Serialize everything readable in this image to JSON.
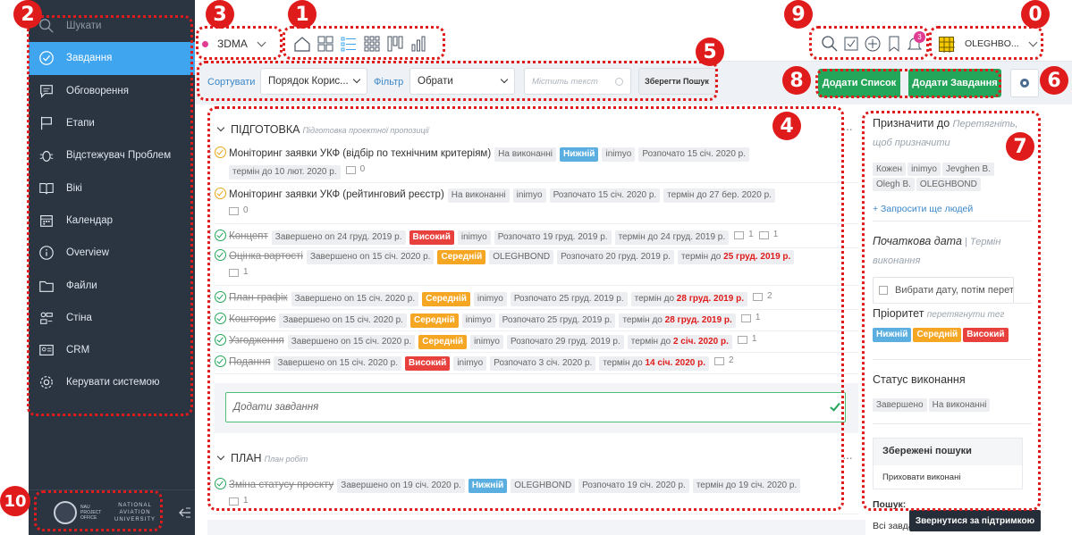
{
  "sidebar": {
    "items": [
      {
        "label": "Шукати",
        "icon": "search-icon"
      },
      {
        "label": "Завдання",
        "icon": "check-circle-icon"
      },
      {
        "label": "Обговорення",
        "icon": "chat-icon"
      },
      {
        "label": "Етапи",
        "icon": "flag-icon"
      },
      {
        "label": "Відстежувач Проблем",
        "icon": "bug-icon"
      },
      {
        "label": "Вікі",
        "icon": "book-icon"
      },
      {
        "label": "Календар",
        "icon": "calendar-icon"
      },
      {
        "label": "Overview",
        "icon": "info-icon"
      },
      {
        "label": "Файли",
        "icon": "folder-icon"
      },
      {
        "label": "Стіна",
        "icon": "wall-icon"
      },
      {
        "label": "CRM",
        "icon": "crm-icon"
      },
      {
        "label": "Керувати системою",
        "icon": "gear-icon"
      }
    ],
    "footer": {
      "logo_text": "NATIONAL AVIATION UNIVERSITY",
      "logo_small": "NAU PROJECT OFFICE"
    }
  },
  "topbar": {
    "project": "ЗDMA",
    "notif_count": "3",
    "user": "OLEGHBO..."
  },
  "toolbar": {
    "sort_label": "Сортувати",
    "sort_value": "Порядок Корис...",
    "filter_label": "Фільтр",
    "filter_value": "Обрати",
    "search_placeholder": "Містить текст",
    "save_search": "Зберегти Пошук",
    "add_list": "Додати Список",
    "add_task": "Додати Завдання"
  },
  "sections": [
    {
      "title": "ПІДГОТОВКА",
      "subtitle": "Підготовка проектної пропозиції",
      "add_placeholder": "Додати завдання"
    },
    {
      "title": "ПЛАН",
      "subtitle": "План робіт"
    }
  ],
  "tasks": [
    {
      "title": "Моніторинг заявки УКФ (відбір по технічним критеріям)",
      "status": "На виконанні",
      "priority": "Нижній",
      "user": "inimyo",
      "started": "Розпочато 15 січ. 2020 р.",
      "due": "термін до 10 лют. 2020 р.",
      "comments": "0"
    },
    {
      "title": "Моніторинг заявки УКФ (рейтинговий реєстр)",
      "status": "На виконанні",
      "user": "inimyo",
      "started": "Розпочато 15 січ. 2020 р.",
      "due": "термін до 27 бер. 2020 р.",
      "comments": "0"
    },
    {
      "title": "Концепт",
      "status": "Завершено on 24 груд. 2019 р.",
      "priority": "Високий",
      "user": "inimyo",
      "started": "Розпочато 19 груд. 2019 р.",
      "due": "термін до 24 груд. 2019 р.",
      "comments": "1",
      "subtasks": "1"
    },
    {
      "title": "Оцінка вартості",
      "status": "Завершено on 15 січ. 2020 р.",
      "priority": "Середній",
      "user": "OLEGHBOND",
      "started": "Розпочато 20 груд. 2019 р.",
      "due_prefix": "термін до ",
      "due_red": "25 груд. 2019 р.",
      "comments": "1"
    },
    {
      "title": "План-графік",
      "status": "Завершено on 15 січ. 2020 р.",
      "priority": "Середній",
      "user": "inimyo",
      "started": "Розпочато 25 груд. 2019 р.",
      "due_prefix": "термін до ",
      "due_red": "28 груд. 2019 р.",
      "comments": "2"
    },
    {
      "title": "Кошторис",
      "status": "Завершено on 15 січ. 2020 р.",
      "priority": "Середній",
      "user": "inimyo",
      "started": "Розпочато 25 груд. 2019 р.",
      "due_prefix": "термін до ",
      "due_red": "28 груд. 2019 р.",
      "comments": "1"
    },
    {
      "title": "Узгодження",
      "status": "Завершено on 15 січ. 2020 р.",
      "priority": "Середній",
      "user": "inimyo",
      "started": "Розпочато 29 груд. 2019 р.",
      "due_prefix": "термін до ",
      "due_red": "2 січ. 2020 р.",
      "comments": "1"
    },
    {
      "title": "Подання",
      "status": "Завершено on 15 січ. 2020 р.",
      "priority": "Високий",
      "user": "inimyo",
      "started": "Розпочато 3 січ. 2020 р.",
      "due_prefix": "термін до ",
      "due_red": "14 січ. 2020 р.",
      "comments": "2"
    },
    {
      "title": "Зміна статусу проєкту",
      "status": "Завершено on 19 січ. 2020 р.",
      "priority": "Нижній",
      "user": "OLEGHBOND",
      "started": "Розпочато 19 січ. 2020 р.",
      "due": "термін до 19 січ. 2020 р.",
      "comments": "1"
    }
  ],
  "right_panel": {
    "assign_title": "Призначити до",
    "assign_hint": "Перетягніть, щоб призначити",
    "people": [
      "Кожен",
      "inimyo",
      "Jevghen B.",
      "Olegh B.",
      "OLEGHBOND"
    ],
    "invite": "+ Запросити ще людей",
    "date_title": "Початкова дата",
    "date_sep": " | ",
    "date_hint": "Термін виконання",
    "date_placeholder": "Вибрати дату, потім перет",
    "priority_title": "Пріоритет",
    "priority_hint": "перетягнути тег",
    "priorities": [
      "Нижній",
      "Середній",
      "Високий"
    ],
    "status_title": "Статус виконання",
    "statuses": [
      "Завершено",
      "На виконанні"
    ],
    "saved_title": "Збережені пошуки",
    "saved_item": "Приховати виконані",
    "search_label": "Пошук:",
    "search_all": "Всі завда..."
  },
  "support": "Звернутися за підтримкою",
  "callouts": [
    "0",
    "1",
    "2",
    "3",
    "4",
    "5",
    "6",
    "7",
    "8",
    "9",
    "10"
  ],
  "colors": {
    "accent": "#3fa5ef",
    "green": "#23a55a",
    "annotation": "#e01b1b"
  }
}
